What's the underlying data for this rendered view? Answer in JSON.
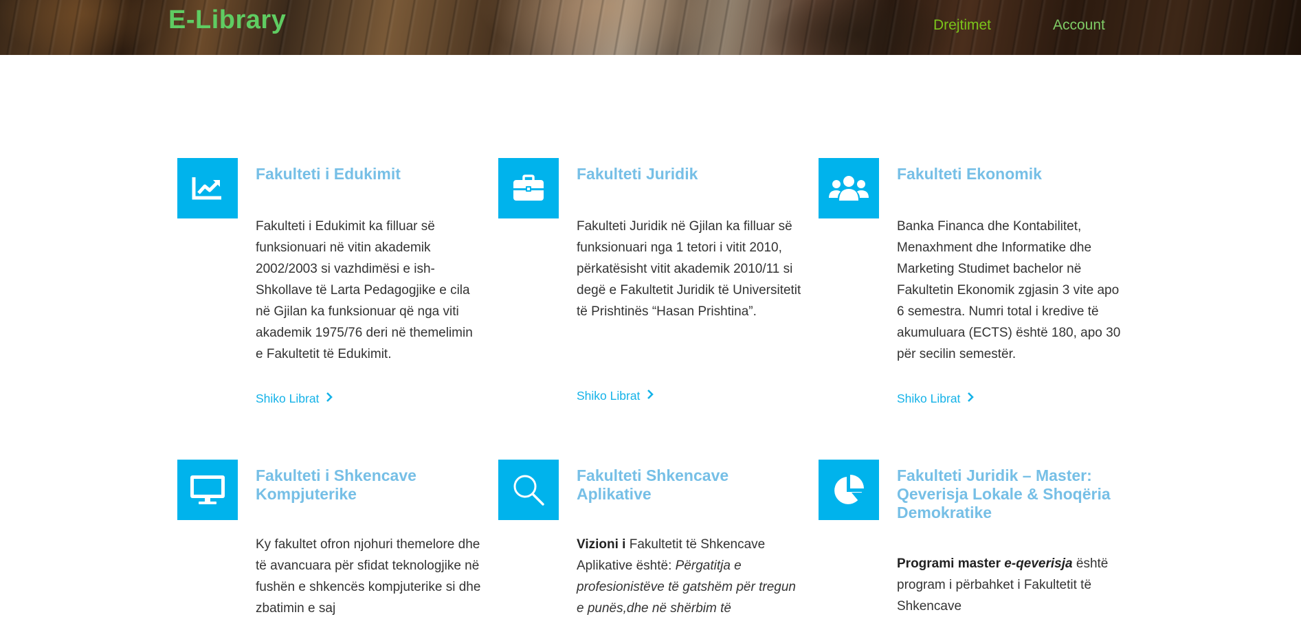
{
  "header": {
    "brand": "E-Library",
    "nav": [
      "Drejtimet",
      "Account"
    ]
  },
  "cards": [
    {
      "icon": "chart-line-icon",
      "title": "Fakulteti i Edukimit",
      "text": "Fakulteti i Edukimit ka filluar së funksionuari në vitin akademik 2002/2003 si vazhdimësi e ish-Shkollave të Larta Pedagogjike e cila në Gjilan ka funksionuar që nga viti akademik 1975/76 deri në themelimin e Fakultetit të Edukimit.",
      "link": "Shiko Librat"
    },
    {
      "icon": "briefcase-icon",
      "title": "Fakulteti Juridik",
      "text": "Fakulteti Juridik në Gjilan ka filluar së funksionuari nga 1 tetori i vitit 2010, përkatësisht vitit akademik 2010/11 si degë e Fakultetit Juridik të Universitetit të Prishtinës “Hasan Prishtina”.",
      "link": "Shiko Librat"
    },
    {
      "icon": "users-icon",
      "title": "Fakulteti Ekonomik",
      "text": "Banka Financa dhe Kontabilitet, Menaxhment dhe Informatike dhe Marketing Studimet bachelor në Fakultetin Ekonomik zgjasin 3 vite apo 6 semestra. Numri total i kredive të akumuluara (ECTS) është 180, apo 30 për secilin semestër.",
      "link": "Shiko Librat"
    },
    {
      "icon": "desktop-icon",
      "title": "Fakulteti i Shkencave Kompjuterike",
      "text": "Ky fakultet ofron njohuri themelore dhe të avancuara për sfidat teknologjike në fushën e shkencës kompjuterike si dhe zbatimin e saj"
    },
    {
      "icon": "search-icon",
      "title": "Fakulteti Shkencave Aplikative",
      "text_bold": "Vizioni i",
      "text_normal": " Fakultetit të Shkencave Aplikative është: ",
      "text_italic": "Përgatitja  e profesionistëve të gatshëm për tregun e punës,dhe në shërbim të"
    },
    {
      "icon": "pie-chart-icon",
      "title": "Fakulteti Juridik – Master: Qeverisja Lokale & Shoqëria Demokratike",
      "text_bold": " Programi master ",
      "text_bold_italic": "e-qeverisja",
      "text_normal": " është program i përbahket i Fakultetit të Shkencave"
    }
  ],
  "colors": {
    "accent": "#00b3ec",
    "title": "#76bfe6",
    "brand": "#5fcc62",
    "link": "#14b2e8"
  }
}
